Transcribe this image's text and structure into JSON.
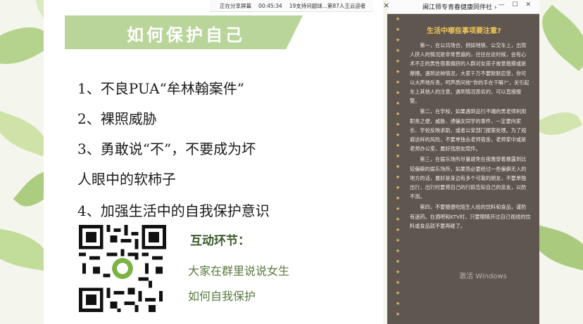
{
  "top_strip": {
    "items": [
      "正在分享屏幕",
      "00:45:34",
      "19支持问题球...第87人王云迎者"
    ]
  },
  "slide": {
    "title": "如何保护自己",
    "points": [
      "1、不良PUA“牟林翰案件”",
      "2、裸照威胁",
      "3、勇敢说“不”，不要成为坏",
      "人眼中的软柿子",
      "4、加强生活中的自我保护意识"
    ],
    "interaction_title": "互动环节：",
    "interaction_lines": [
      "大家在群里说说女生",
      "如何自我保护"
    ]
  },
  "right_panel": {
    "header_title": "闽江师专青春健康同伴社 ›",
    "close_icon": "×",
    "buttons": "— ☐ ✕",
    "title": "生活中哪些事项要注意?",
    "paragraphs": [
      "第一，在公共场合，例如地铁、公交车上，出现人挤人的情况是非常普遍的，往往在这时候，会有心术不正的男性借着拥挤的人群对女孩子故意揩摸或是摩擦。遇到这种情况，大家千万不要默默忍受，你可以大声地斥责，呵声质问他“你的手在干嘛?”，关引起车上其他人的注意，遇到情况恶劣的，可以直接报警。",
      "第二，在学校，如果遇到品行不端的男老师利用职务之便，威胁、诱骗女同学的事件，一定要向家长、学校反映求助，或者公安部门报案处理。为了规避这样的风险，不要单独去老师宿舍，老师家中或是老师办公室，最好找朋友陪伴。",
      "第三，在娱乐场所尽量避免在夜晚穿着暴露到比较偏僻的娱乐场所，如果势必要经过一些偏僻无人的地方的话，最好是身边有多个可靠的朋友，不要单独出行，出行时要将自己的行踪告知自己的亲友，以防不测。",
      "第四，不要随便吃陌生人给的饮料和食品，谨防有迷药。在酒吧和KTV时，只要眼睛开过自己视线的饮料或食品就不要再碰了。"
    ],
    "watermark": "激活 Windows"
  }
}
